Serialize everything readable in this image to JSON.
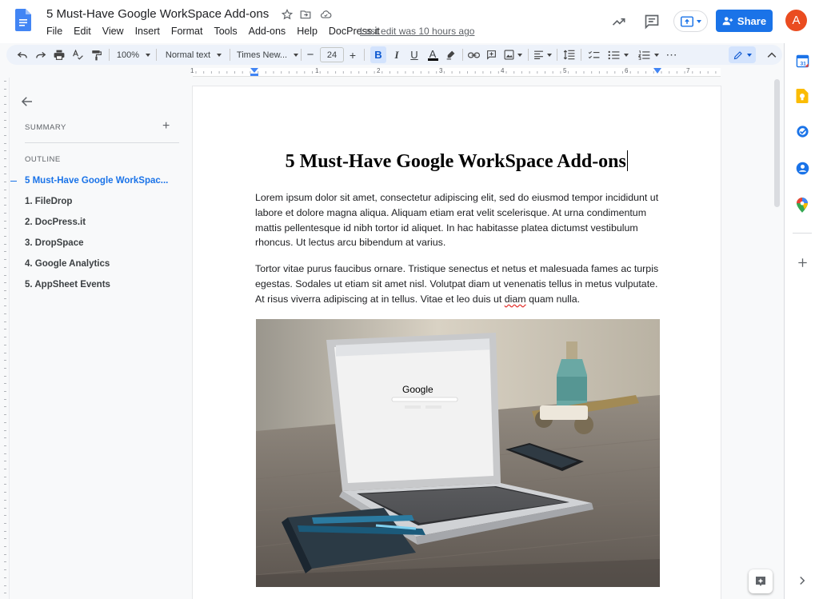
{
  "header": {
    "doc_title": "5 Must-Have Google WorkSpace Add-ons",
    "last_edit": "Last edit was 10 hours ago",
    "share_label": "Share",
    "avatar_letter": "A",
    "menu": [
      "File",
      "Edit",
      "View",
      "Insert",
      "Format",
      "Tools",
      "Add-ons",
      "Help",
      "DocPress.it"
    ]
  },
  "toolbar": {
    "zoom": "100%",
    "style": "Normal text",
    "font": "Times New...",
    "font_size": "24"
  },
  "ruler": {
    "numbers": [
      "1",
      "1",
      "2",
      "3",
      "4",
      "5",
      "6",
      "7"
    ]
  },
  "outline_panel": {
    "summary_label": "SUMMARY",
    "outline_label": "OUTLINE",
    "items": [
      {
        "label": "5 Must-Have Google WorkSpac..."
      },
      {
        "label": "1. FileDrop"
      },
      {
        "label": "2. DocPress.it"
      },
      {
        "label": "3. DropSpace"
      },
      {
        "label": "4. Google Analytics"
      },
      {
        "label": "5. AppSheet Events"
      }
    ]
  },
  "document": {
    "heading": "5 Must-Have Google WorkSpace Add-ons",
    "paragraph1": "Lorem ipsum dolor sit amet, consectetur adipiscing elit, sed do eiusmod tempor incididunt ut labore et dolore magna aliqua. Aliquam etiam erat velit scelerisque. At urna condimentum mattis pellentesque id nibh tortor id aliquet. In hac habitasse platea dictumst vestibulum rhoncus. Ut lectus arcu bibendum at varius.",
    "paragraph2_before": "Tortor vitae purus faucibus ornare. Tristique senectus et netus et malesuada fames ac turpis egestas. Sodales ut etiam sit amet nisl. Volutpat diam ut venenatis tellus in metus vulputate. At risus viverra adipiscing at in tellus. Vitae et leo duis ut ",
    "paragraph2_misspelled": "diam",
    "paragraph2_after": " quam nulla.",
    "image_screen_logo": "Google"
  },
  "colors": {
    "accent": "#1a73e8",
    "avatar": "#ea4c20",
    "toolbar_bg": "#edf2fa"
  },
  "icons": {
    "header": [
      "docs-logo",
      "star-icon",
      "move-to-folder-icon",
      "cloud-saved-icon",
      "activity-trend-icon",
      "comments-icon",
      "present-icon",
      "share-person-icon"
    ],
    "side_panel": [
      "calendar-icon",
      "keep-icon",
      "tasks-icon",
      "contacts-icon",
      "maps-icon",
      "add-icon",
      "chevron-right-icon"
    ]
  }
}
